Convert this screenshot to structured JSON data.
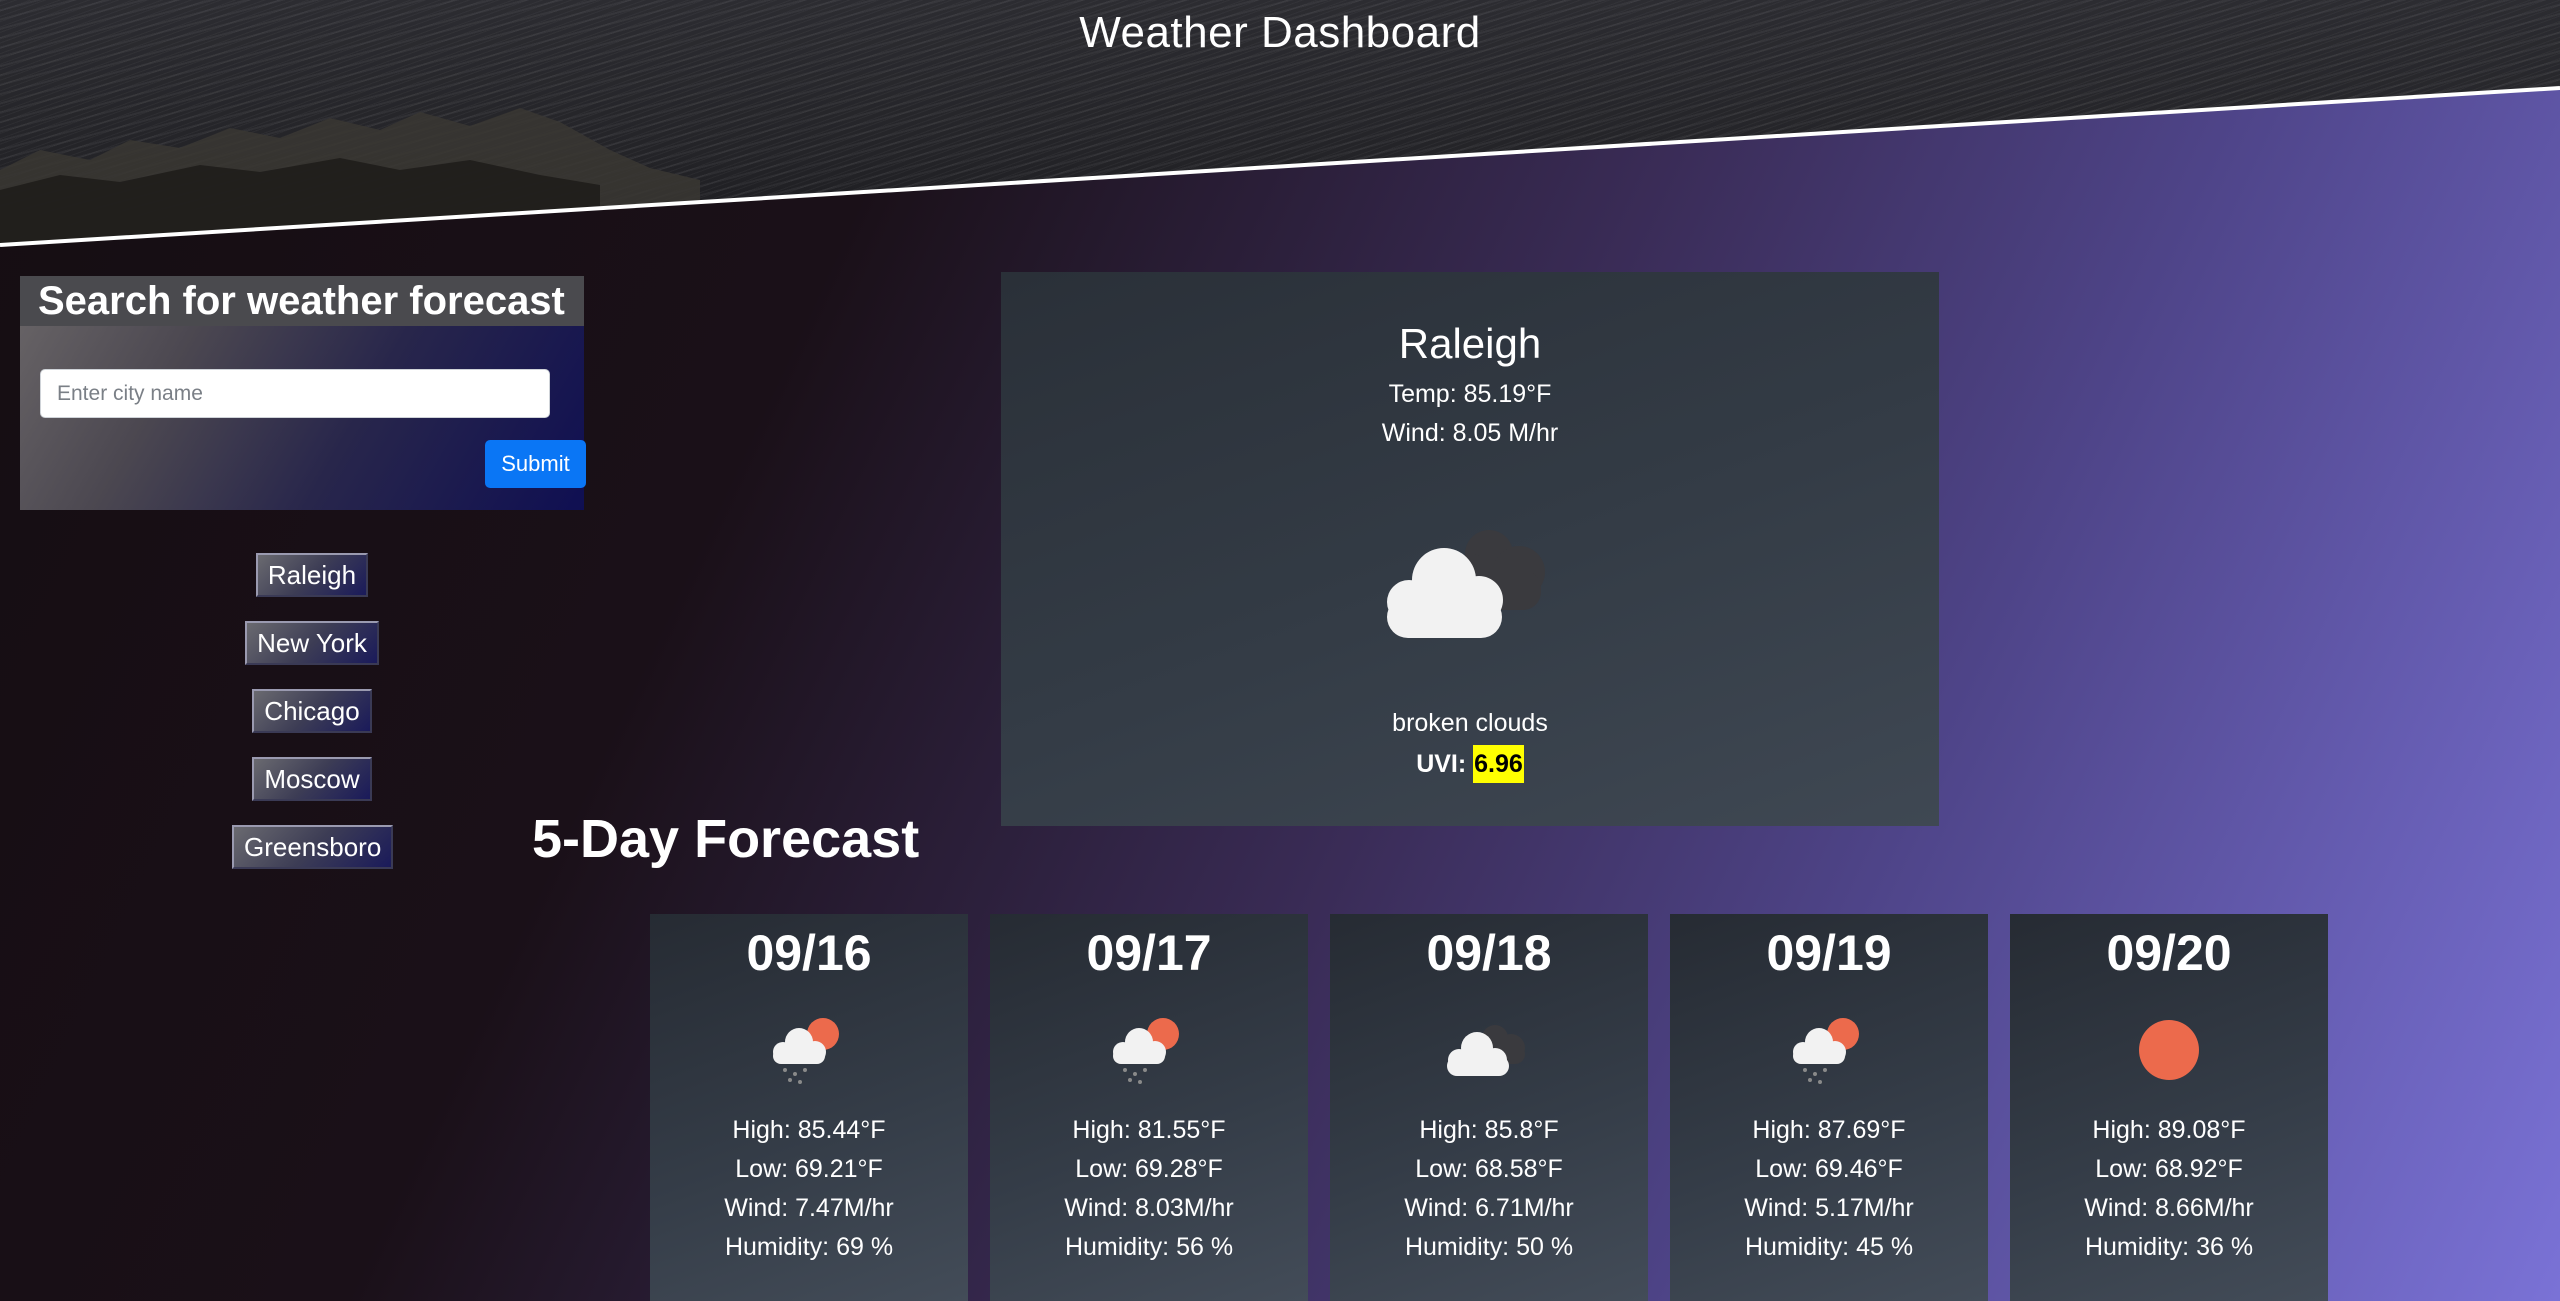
{
  "header": {
    "title": "Weather Dashboard"
  },
  "search": {
    "heading": "Search for weather forecast",
    "placeholder": "Enter city name",
    "value": "",
    "submit_label": "Submit"
  },
  "history": [
    "Raleigh",
    "New York",
    "Chicago",
    "Moscow",
    "Greensboro"
  ],
  "current": {
    "city": "Raleigh",
    "temp": "Temp: 85.19°F",
    "wind": "Wind: 8.05 M/hr",
    "icon": "broken-clouds-icon",
    "description": "broken clouds",
    "uvi_label": "UVI:",
    "uvi_value": "6.96",
    "uvi_color": "#ffff00"
  },
  "forecast": {
    "title": "5-Day Forecast",
    "days": [
      {
        "date": "09/16",
        "icon": "rain-sun-icon",
        "high": "High: 85.44°F",
        "low": "Low: 69.21°F",
        "wind": "Wind: 7.47M/hr",
        "humidity": "Humidity: 69 %"
      },
      {
        "date": "09/17",
        "icon": "rain-sun-icon",
        "high": "High: 81.55°F",
        "low": "Low: 69.28°F",
        "wind": "Wind: 8.03M/hr",
        "humidity": "Humidity: 56 %"
      },
      {
        "date": "09/18",
        "icon": "broken-clouds-icon",
        "high": "High: 85.8°F",
        "low": "Low: 68.58°F",
        "wind": "Wind: 6.71M/hr",
        "humidity": "Humidity: 50 %"
      },
      {
        "date": "09/19",
        "icon": "rain-sun-icon",
        "high": "High: 87.69°F",
        "low": "Low: 69.46°F",
        "wind": "Wind: 5.17M/hr",
        "humidity": "Humidity: 45 %"
      },
      {
        "date": "09/20",
        "icon": "clear-sun-icon",
        "high": "High: 89.08°F",
        "low": "Low: 68.92°F",
        "wind": "Wind: 8.66M/hr",
        "humidity": "Humidity: 36 %"
      }
    ]
  }
}
